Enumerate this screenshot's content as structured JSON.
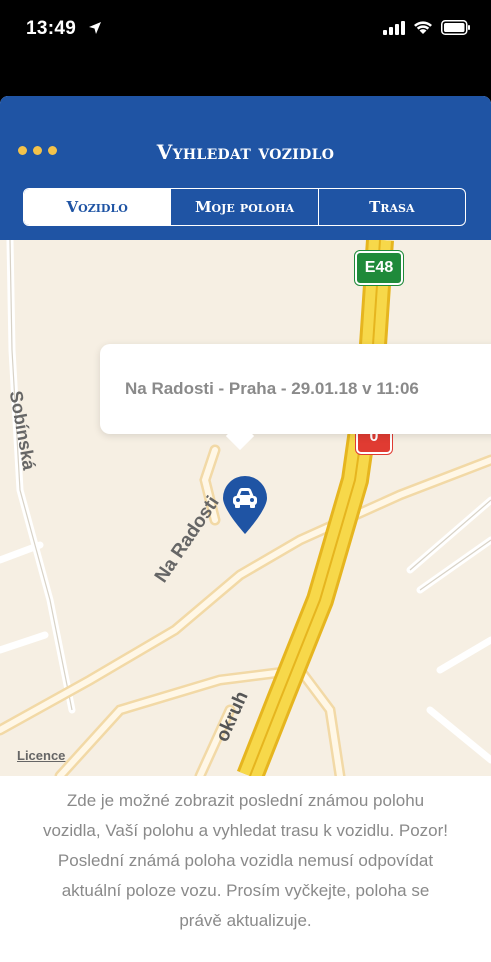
{
  "status": {
    "time": "13:49",
    "icons": [
      "location-arrow-icon",
      "signal-icon",
      "wifi-icon",
      "battery-icon"
    ]
  },
  "header": {
    "title": "Vyhledat vozidlo",
    "tabs": [
      {
        "label": "Vozidlo",
        "active": true
      },
      {
        "label": "Moje poloha",
        "active": false
      },
      {
        "label": "Trasa",
        "active": false
      }
    ]
  },
  "map": {
    "street_labels": [
      "Sobínská",
      "Na Radosti",
      "okruh"
    ],
    "road_shields": [
      "E48",
      "0"
    ],
    "callout": "Na Radosti - Praha - 29.01.18 v 11:06",
    "marker_icon": "car-icon",
    "licence": "Licence"
  },
  "info_text": "Zde je možné zobrazit poslední známou polohu vozidla, Vaší polohu a vyhledat trasu k vozidlu. Pozor! Poslední známá poloha vozidla nemusí odpovídat aktuální poloze vozu. Prosím vyčkejte, poloha se právě aktualizuje.",
  "colors": {
    "brand": "#1f54a4",
    "accent": "#f3c24a",
    "map_background": "#f6efe3",
    "highway": "#f5c92e",
    "shield_green": "#1f8a3a",
    "shield_red": "#e03b32"
  }
}
